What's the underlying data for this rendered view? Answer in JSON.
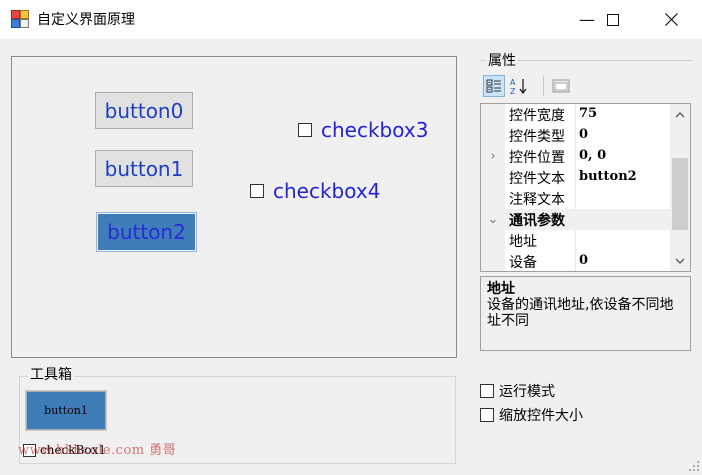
{
  "window": {
    "title": "自定义界面原理",
    "minimize_glyph": "—",
    "maximize_glyph": "☐",
    "close_glyph": "✕"
  },
  "canvas": {
    "buttons": [
      {
        "label": "button0",
        "selected": false
      },
      {
        "label": "button1",
        "selected": false
      },
      {
        "label": "button2",
        "selected": true
      }
    ],
    "checkboxes": [
      {
        "label": "checkbox3"
      },
      {
        "label": "checkbox4"
      }
    ]
  },
  "properties": {
    "group_label": "属性",
    "toolbar": [
      "categorized-icon",
      "alphabetical-icon",
      "property-pages-icon"
    ],
    "rows": [
      {
        "name": "控件宽度",
        "value": "75"
      },
      {
        "name": "控件类型",
        "value": "0"
      },
      {
        "name": "控件位置",
        "value": "0, 0",
        "expander": "›"
      },
      {
        "name": "控件文本",
        "value": "button2"
      },
      {
        "name": "注释文本",
        "value": ""
      },
      {
        "name": "通讯参数",
        "value": "",
        "category": true,
        "expander": "⌄"
      },
      {
        "name": "地址",
        "value": ""
      },
      {
        "name": "设备",
        "value": "0"
      }
    ],
    "description_title": "地址",
    "description_text": "设备的通讯地址,依设备不同地址不同"
  },
  "toolbox": {
    "label": "工具箱",
    "button_item": "button1",
    "checkbox_item": "checkBox1",
    "watermark": "www.hkhcole.com 勇哥"
  },
  "options": {
    "run_mode": "运行模式",
    "scale_controls": "缩放控件大小"
  }
}
